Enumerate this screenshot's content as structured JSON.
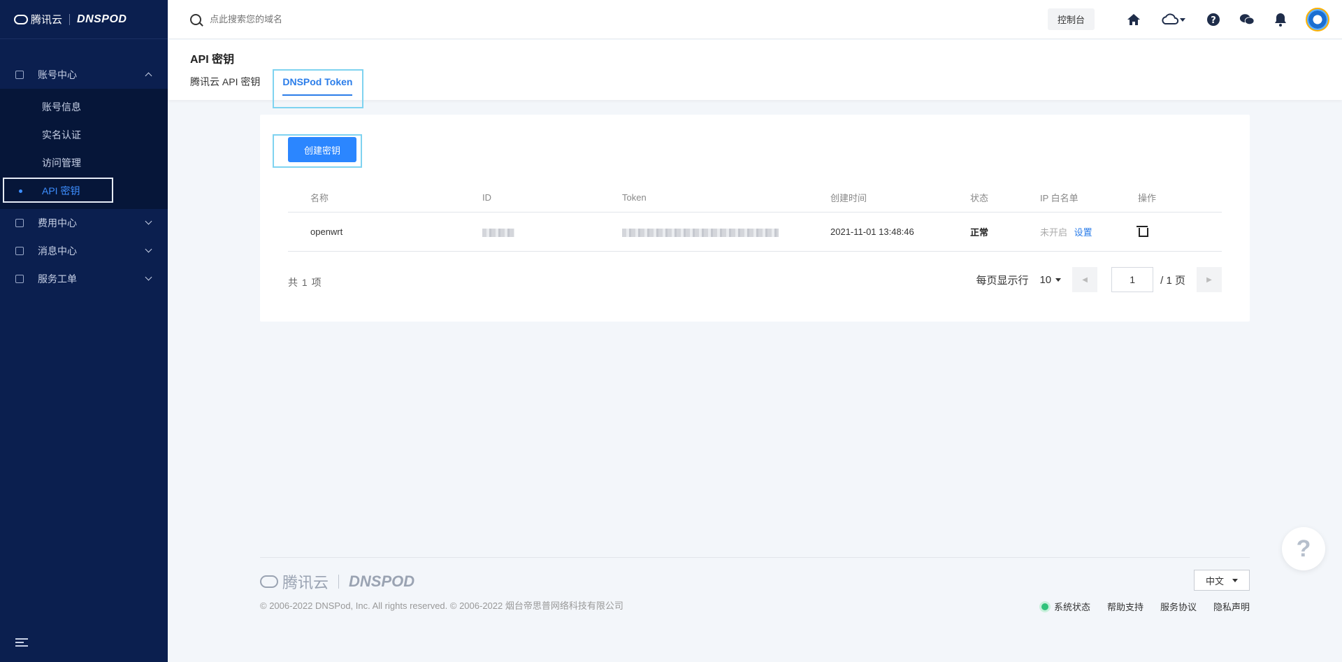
{
  "brand": {
    "left": "腾讯云",
    "right": "DNSPOD"
  },
  "header": {
    "search_placeholder": "点此搜索您的域名",
    "console_label": "控制台"
  },
  "sidebar": {
    "groups": [
      {
        "label": "账号中心",
        "expanded": true,
        "items": [
          "账号信息",
          "实名认证",
          "访问管理",
          "API 密钥"
        ],
        "active": "API 密钥"
      },
      {
        "label": "费用中心",
        "expanded": false
      },
      {
        "label": "消息中心",
        "expanded": false
      },
      {
        "label": "服务工单",
        "expanded": false
      }
    ]
  },
  "page": {
    "title": "API 密钥",
    "tabs": [
      "腾讯云 API 密钥",
      "DNSPod Token"
    ],
    "active_tab": "DNSPod Token"
  },
  "card": {
    "create_button": "创建密钥",
    "columns": [
      "名称",
      "ID",
      "Token",
      "创建时间",
      "状态",
      "IP 白名单",
      "操作"
    ],
    "rows": [
      {
        "name": "openwrt",
        "created": "2021-11-01 13:48:46",
        "status": "正常",
        "ip_state": "未开启",
        "ip_action": "设置"
      }
    ],
    "total_label": "共 1 项",
    "pager": {
      "per_page_label": "每页显示行",
      "per_page": "10",
      "current": "1",
      "total_pages": "/ 1 页"
    }
  },
  "footer": {
    "logo_left": "腾讯云",
    "logo_right": "DNSPOD",
    "copyright": "© 2006-2022 DNSPod, Inc. All rights reserved. © 2006-2022 烟台帝思普网络科技有限公司",
    "lang": "中文",
    "links": [
      "系统状态",
      "帮助支持",
      "服务协议",
      "隐私声明"
    ]
  },
  "help_label": "?"
}
